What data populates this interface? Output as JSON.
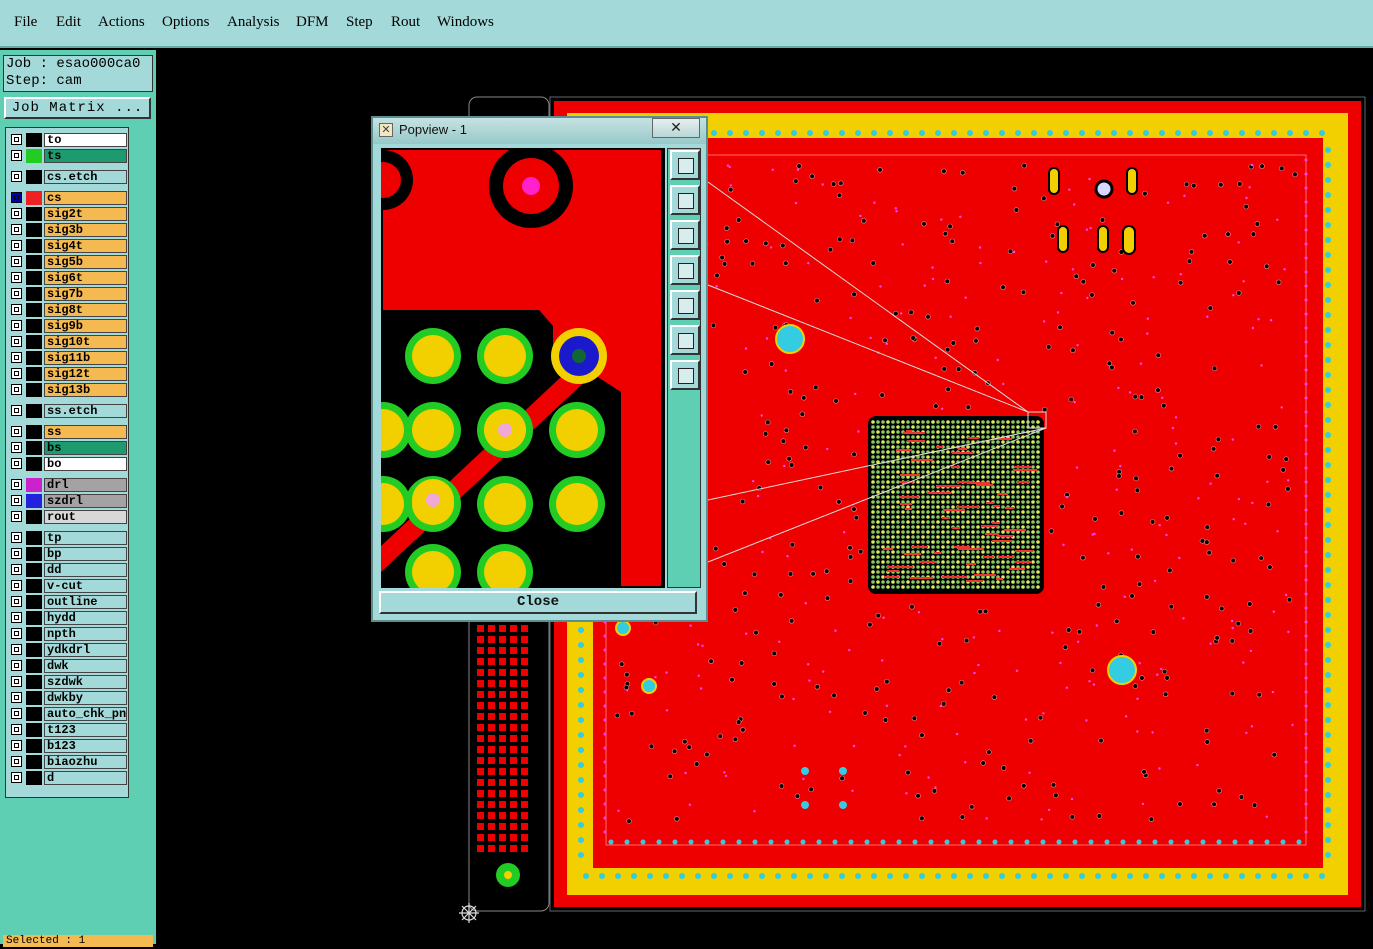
{
  "menu": [
    "File",
    "Edit",
    "Actions",
    "Options",
    "Analysis",
    "DFM",
    "Step",
    "Rout",
    "Windows"
  ],
  "job": {
    "job_line": "Job : esao000ca0",
    "step_line": "Step: cam"
  },
  "job_matrix_label": "Job Matrix ...",
  "layers": [
    {
      "name": "to",
      "color": "#ffffff",
      "swatch": "#000000"
    },
    {
      "name": "ts",
      "color": "#1e9b6e",
      "swatch": "#22cc22"
    },
    {
      "name": "cs.etch",
      "color": "#a3d9d9",
      "swatch": "#000000"
    },
    {
      "name": "cs",
      "color": "#f5b952",
      "swatch": "#000088",
      "active": true
    },
    {
      "name": "sig2t",
      "color": "#f5b952",
      "swatch": "#000000"
    },
    {
      "name": "sig3b",
      "color": "#f5b952",
      "swatch": "#000000"
    },
    {
      "name": "sig4t",
      "color": "#f5b952",
      "swatch": "#000000"
    },
    {
      "name": "sig5b",
      "color": "#f5b952",
      "swatch": "#000000"
    },
    {
      "name": "sig6t",
      "color": "#f5b952",
      "swatch": "#000000"
    },
    {
      "name": "sig7b",
      "color": "#f5b952",
      "swatch": "#000000"
    },
    {
      "name": "sig8t",
      "color": "#f5b952",
      "swatch": "#000000"
    },
    {
      "name": "sig9b",
      "color": "#f5b952",
      "swatch": "#000000"
    },
    {
      "name": "sig10t",
      "color": "#f5b952",
      "swatch": "#000000"
    },
    {
      "name": "sig11b",
      "color": "#f5b952",
      "swatch": "#000000"
    },
    {
      "name": "sig12t",
      "color": "#f5b952",
      "swatch": "#000000"
    },
    {
      "name": "sig13b",
      "color": "#f5b952",
      "swatch": "#000000"
    },
    {
      "name": "ss.etch",
      "color": "#a3d9d9",
      "swatch": "#000000"
    },
    {
      "name": "ss",
      "color": "#f5b952",
      "swatch": "#000000"
    },
    {
      "name": "bs",
      "color": "#1e9b6e",
      "swatch": "#000000"
    },
    {
      "name": "bo",
      "color": "#ffffff",
      "swatch": "#000000"
    },
    {
      "name": "drl",
      "color": "#a3a3a3",
      "swatch": "#cc22cc"
    },
    {
      "name": "szdrl",
      "color": "#a3a3a3",
      "swatch": "#2222dd"
    },
    {
      "name": "rout",
      "color": "#d8d8d8",
      "swatch": "#000000"
    },
    {
      "name": "tp",
      "color": "#a3d9d9",
      "swatch": "#000000"
    },
    {
      "name": "bp",
      "color": "#a3d9d9",
      "swatch": "#000000"
    },
    {
      "name": "dd",
      "color": "#a3d9d9",
      "swatch": "#000000"
    },
    {
      "name": "v-cut",
      "color": "#a3d9d9",
      "swatch": "#000000"
    },
    {
      "name": "outline",
      "color": "#a3d9d9",
      "swatch": "#000000"
    },
    {
      "name": "hydd",
      "color": "#a3d9d9",
      "swatch": "#000000"
    },
    {
      "name": "npth",
      "color": "#a3d9d9",
      "swatch": "#000000"
    },
    {
      "name": "ydkdrl",
      "color": "#a3d9d9",
      "swatch": "#000000"
    },
    {
      "name": "dwk",
      "color": "#a3d9d9",
      "swatch": "#000000"
    },
    {
      "name": "szdwk",
      "color": "#a3d9d9",
      "swatch": "#000000"
    },
    {
      "name": "dwkby",
      "color": "#a3d9d9",
      "swatch": "#000000"
    },
    {
      "name": "auto_chk_pnl",
      "color": "#a3d9d9",
      "swatch": "#000000"
    },
    {
      "name": "t123",
      "color": "#a3d9d9",
      "swatch": "#000000"
    },
    {
      "name": "b123",
      "color": "#a3d9d9",
      "swatch": "#000000"
    },
    {
      "name": "biaozhu",
      "color": "#a3d9d9",
      "swatch": "#000000"
    },
    {
      "name": "d",
      "color": "#a3d9d9",
      "swatch": "#000000"
    }
  ],
  "status": "Selected : 1",
  "popup": {
    "title": "Popview - 1",
    "close_label": "Close"
  },
  "colors": {
    "board_red": "#ee0000",
    "copper_yellow": "#f2d000",
    "pad_green": "#22cc22",
    "via_cyan": "#33cce0",
    "menu_bg": "#a3d9d9",
    "panel_bg": "#5fcfb4"
  }
}
